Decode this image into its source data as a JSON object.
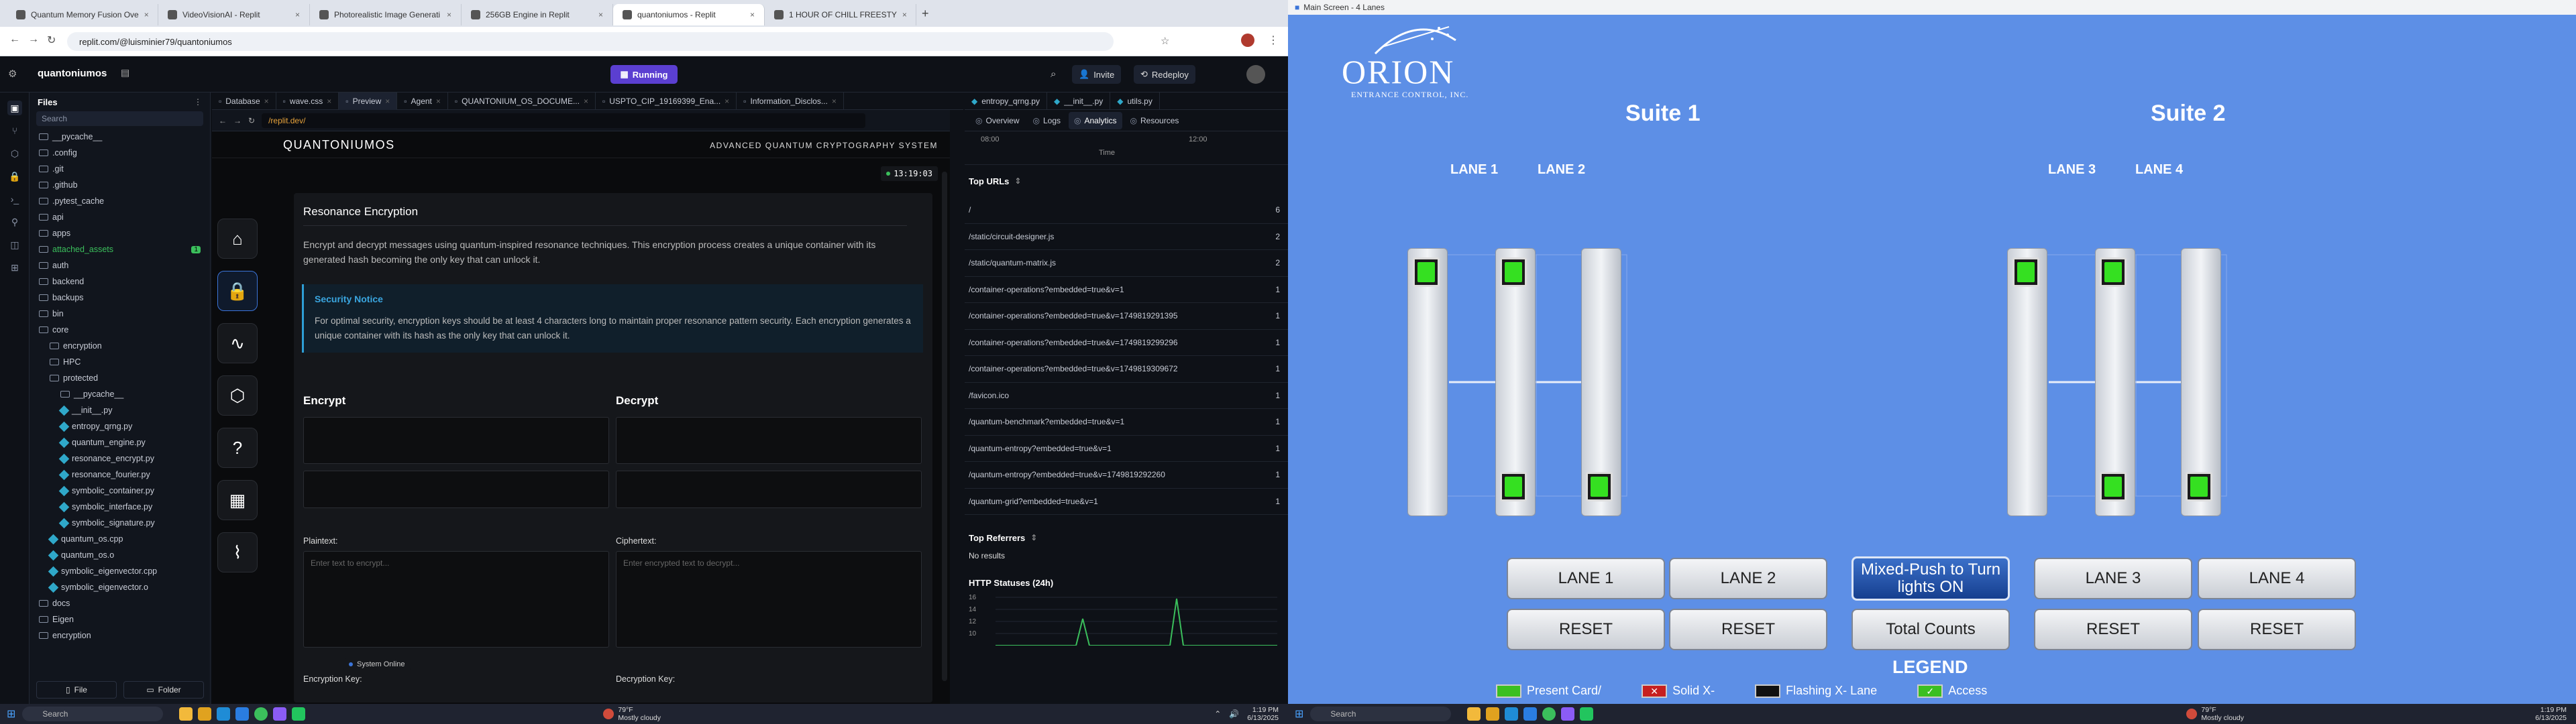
{
  "left_screen": {
    "browser_tabs": [
      {
        "label": "Quantum Memory Fusion Ove"
      },
      {
        "label": "VideoVisionAI - Replit"
      },
      {
        "label": "Photorealistic Image Generati"
      },
      {
        "label": "256GB Engine in Replit"
      },
      {
        "label": "quantoniumos - Replit",
        "active": true
      },
      {
        "label": "1 HOUR OF CHILL FREESTY"
      }
    ],
    "url": "replit.com/@luisminier79/quantoniumos",
    "project_name": "quantoniumos",
    "running_label": "Running",
    "header_buttons": {
      "invite": "Invite",
      "redeploy": "Redeploy"
    },
    "files_panel": {
      "title": "Files",
      "search_placeholder": "Search",
      "items": [
        {
          "name": "__pycache__",
          "type": "folder",
          "indent": 0
        },
        {
          "name": ".config",
          "type": "folder",
          "indent": 0
        },
        {
          "name": ".git",
          "type": "folder",
          "indent": 0
        },
        {
          "name": ".github",
          "type": "folder",
          "indent": 0
        },
        {
          "name": ".pytest_cache",
          "type": "folder",
          "indent": 0
        },
        {
          "name": "api",
          "type": "folder",
          "indent": 0
        },
        {
          "name": "apps",
          "type": "folder",
          "indent": 0
        },
        {
          "name": "attached_assets",
          "type": "folder",
          "indent": 0,
          "highlight": true,
          "badge": "1"
        },
        {
          "name": "auth",
          "type": "folder",
          "indent": 0
        },
        {
          "name": "backend",
          "type": "folder",
          "indent": 0
        },
        {
          "name": "backups",
          "type": "folder",
          "indent": 0
        },
        {
          "name": "bin",
          "type": "folder",
          "indent": 0
        },
        {
          "name": "core",
          "type": "folder",
          "indent": 0
        },
        {
          "name": "encryption",
          "type": "folder",
          "indent": 1
        },
        {
          "name": "HPC",
          "type": "folder",
          "indent": 1
        },
        {
          "name": "protected",
          "type": "folder",
          "indent": 1
        },
        {
          "name": "__pycache__",
          "type": "folder",
          "indent": 2
        },
        {
          "name": "__init__.py",
          "type": "file",
          "indent": 2
        },
        {
          "name": "entropy_qrng.py",
          "type": "file",
          "indent": 2
        },
        {
          "name": "quantum_engine.py",
          "type": "file",
          "indent": 2
        },
        {
          "name": "resonance_encrypt.py",
          "type": "file",
          "indent": 2
        },
        {
          "name": "resonance_fourier.py",
          "type": "file",
          "indent": 2
        },
        {
          "name": "symbolic_container.py",
          "type": "file",
          "indent": 2
        },
        {
          "name": "symbolic_interface.py",
          "type": "file",
          "indent": 2
        },
        {
          "name": "symbolic_signature.py",
          "type": "file",
          "indent": 2
        },
        {
          "name": "quantum_os.cpp",
          "type": "file",
          "indent": 1
        },
        {
          "name": "quantum_os.o",
          "type": "file",
          "indent": 1
        },
        {
          "name": "symbolic_eigenvector.cpp",
          "type": "file",
          "indent": 1
        },
        {
          "name": "symbolic_eigenvector.o",
          "type": "file",
          "indent": 1
        },
        {
          "name": "docs",
          "type": "folder",
          "indent": 0
        },
        {
          "name": "Eigen",
          "type": "folder",
          "indent": 0
        },
        {
          "name": "encryption",
          "type": "folder",
          "indent": 0
        }
      ],
      "new_file": "File",
      "new_folder": "Folder"
    },
    "editor_tabs": [
      {
        "label": "Database"
      },
      {
        "label": "wave.css"
      },
      {
        "label": "Preview",
        "active": true
      },
      {
        "label": "Agent"
      },
      {
        "label": "QUANTONIUM_OS_DOCUME..."
      },
      {
        "label": "USPTO_CIP_19169399_Ena..."
      },
      {
        "label": "Information_Disclos..."
      }
    ],
    "preview_url": "/replit.dev/",
    "app": {
      "logo": "QUANTONIUMOS",
      "subtitle": "ADVANCED QUANTUM CRYPTOGRAPHY SYSTEM",
      "clock": "13:19:03",
      "card_title": "Resonance Encryption",
      "card_desc": "Encrypt and decrypt messages using quantum-inspired resonance techniques. This encryption process creates a unique container with its generated hash becoming the only key that can unlock it.",
      "notice_title": "Security Notice",
      "notice_text": "For optimal security, encryption keys should be at least 4 characters long to maintain proper resonance pattern security. Each encryption generates a unique container with its hash as the only key that can unlock it.",
      "encrypt_heading": "Encrypt",
      "decrypt_heading": "Decrypt",
      "plaintext_label": "Plaintext:",
      "plaintext_placeholder": "Enter text to encrypt...",
      "ciphertext_label": "Ciphertext:",
      "ciphertext_placeholder": "Enter encrypted text to decrypt...",
      "enc_key_label": "Encryption Key:",
      "dec_key_label": "Decryption Key:",
      "status": "System Online"
    },
    "analytics": {
      "file_tabs": [
        "entropy_qrng.py",
        "__init__.py",
        "utils.py"
      ],
      "tabs": [
        "Overview",
        "Logs",
        "Analytics",
        "Resources"
      ],
      "active_tab": "Analytics",
      "time_ticks": [
        "08:00",
        "12:00"
      ],
      "time_label": "Time",
      "top_urls_title": "Top URLs",
      "top_urls": [
        {
          "url": "/",
          "count": "6"
        },
        {
          "url": "/static/circuit-designer.js",
          "count": "2"
        },
        {
          "url": "/static/quantum-matrix.js",
          "count": "2"
        },
        {
          "url": "/container-operations?embedded=true&v=1",
          "count": "1"
        },
        {
          "url": "/container-operations?embedded=true&v=1749819291395",
          "count": "1"
        },
        {
          "url": "/container-operations?embedded=true&v=1749819299296",
          "count": "1"
        },
        {
          "url": "/container-operations?embedded=true&v=1749819309672",
          "count": "1"
        },
        {
          "url": "/favicon.ico",
          "count": "1"
        },
        {
          "url": "/quantum-benchmark?embedded=true&v=1",
          "count": "1"
        },
        {
          "url": "/quantum-entropy?embedded=true&v=1",
          "count": "1"
        },
        {
          "url": "/quantum-entropy?embedded=true&v=1749819292260",
          "count": "1"
        },
        {
          "url": "/quantum-grid?embedded=true&v=1",
          "count": "1"
        }
      ],
      "referrers_title": "Top Referrers",
      "referrers_empty": "No results",
      "http_title": "HTTP Statuses (24h)",
      "http_ticks": [
        "16",
        "14",
        "12",
        "10"
      ]
    },
    "taskbar": {
      "search": "Search",
      "weather_temp": "79°F",
      "weather_desc": "Mostly cloudy",
      "time": "1:19 PM",
      "date": "6/13/2025"
    }
  },
  "right_screen": {
    "window_title": "Main Screen - 4 Lanes",
    "logo_text": "ORION",
    "logo_sub": "ENTRANCE CONTROL, INC.",
    "suite1": "Suite 1",
    "suite2": "Suite 2",
    "lanes": [
      "LANE 1",
      "LANE 2",
      "LANE 3",
      "LANE 4"
    ],
    "buttons": {
      "lane1": "LANE 1",
      "lane2": "LANE 2",
      "mixed": "Mixed-Push to Turn lights ON",
      "lane3": "LANE 3",
      "lane4": "LANE 4",
      "reset": "RESET",
      "total": "Total Counts"
    },
    "legend_title": "LEGEND",
    "legend_items": [
      "Present Card/",
      "Solid X-",
      "Flashing X- Lane",
      "Access"
    ],
    "taskbar": {
      "search": "Search",
      "weather_temp": "79°F",
      "weather_desc": "Mostly cloudy",
      "time": "1:19 PM",
      "date": "6/13/2025"
    }
  },
  "colors": {
    "accent": "#5b3fd1",
    "app_blue": "#3b74d8",
    "notice": "#2e9fd6",
    "screen_blue": "#5d8fe6",
    "green_light": "#35e021"
  }
}
